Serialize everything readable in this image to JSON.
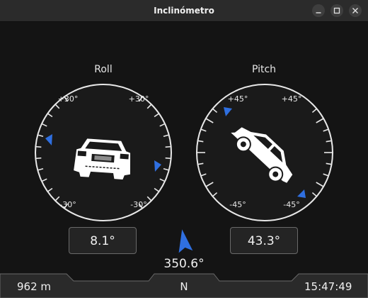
{
  "window": {
    "title": "Inclinómetro",
    "buttons": [
      "minimize-icon",
      "maximize-icon",
      "close-icon"
    ]
  },
  "roll": {
    "label": "Roll",
    "ticks": {
      "top_left": "+30°",
      "top_right": "+30°",
      "bottom_left": "-30°",
      "bottom_right": "-30°"
    },
    "value": 8.1,
    "value_text": "8.1°"
  },
  "pitch": {
    "label": "Pitch",
    "ticks": {
      "top_left": "+45°",
      "top_right": "+45°",
      "bottom_left": "-45°",
      "bottom_right": "-45°"
    },
    "value": 43.3,
    "value_text": "43.3°"
  },
  "heading": {
    "value": 350.6,
    "value_text": "350.6°",
    "direction": "N"
  },
  "status": {
    "altitude": "962 m",
    "time": "15:47:49"
  },
  "colors": {
    "accent_marker": "#2f6fe0",
    "background": "#141414",
    "dial_stroke": "#e8e8e8"
  }
}
